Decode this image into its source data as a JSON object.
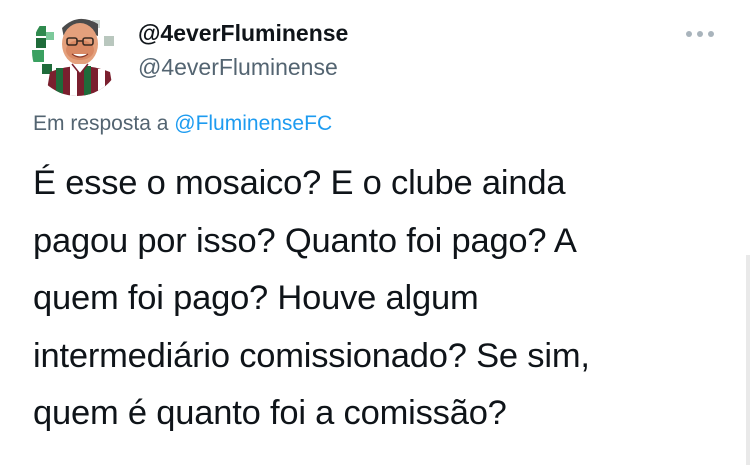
{
  "author": {
    "display_name": "@4everFluminense",
    "handle": "@4everFluminense"
  },
  "reply": {
    "prefix": "Em resposta a",
    "mention": "@FluminenseFC"
  },
  "tweet": {
    "lines": [
      "É esse o mosaico? E o clube ainda",
      "pagou por isso? Quanto foi pago? A",
      "quem foi pago? Houve algum",
      "intermediário comissionado? Se sim,",
      "quem é quanto foi a comissão?"
    ]
  },
  "icons": {
    "more": "more-horizontal-icon",
    "avatar": "avatar-image"
  },
  "colors": {
    "text": "#0f1419",
    "secondary": "#536471",
    "link": "#1d9bf0",
    "club_maroon": "#7a1f2e",
    "club_green": "#1f6b3a"
  }
}
